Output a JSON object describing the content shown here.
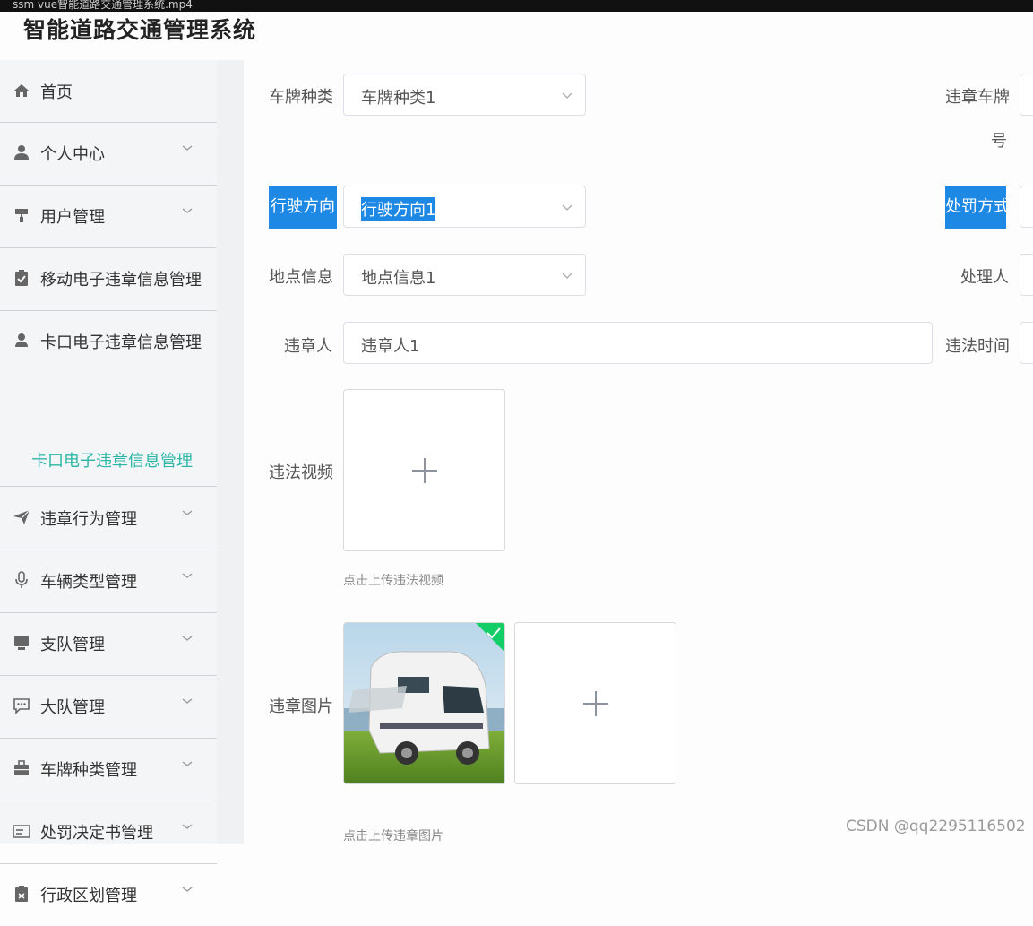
{
  "video_bar": {
    "title": "ssm vue智能道路交通管理系统.mp4"
  },
  "app": {
    "title": "智能道路交通管理系统"
  },
  "sidebar": {
    "items": [
      {
        "label": "首页",
        "icon": "home-icon"
      },
      {
        "label": "个人中心",
        "icon": "user-icon"
      },
      {
        "label": "用户管理",
        "icon": "paint-roller-icon"
      },
      {
        "label": "移动电子违章信息管理",
        "icon": "clipboard-check-icon"
      },
      {
        "label": "卡口电子违章信息管理",
        "icon": "user-tie-icon"
      },
      {
        "label": "违章行为管理",
        "icon": "paper-plane-icon"
      },
      {
        "label": "车辆类型管理",
        "icon": "microphone-icon"
      },
      {
        "label": "支队管理",
        "icon": "desktop-icon"
      },
      {
        "label": "大队管理",
        "icon": "chat-icon"
      },
      {
        "label": "车牌种类管理",
        "icon": "briefcase-icon"
      },
      {
        "label": "处罚决定书管理",
        "icon": "id-card-icon"
      },
      {
        "label": "行政区划管理",
        "icon": "clipboard-icon"
      }
    ],
    "submenu_active": "卡口电子违章信息管理",
    "active_color": "#2bb6a6"
  },
  "form": {
    "plate_type": {
      "label": "车牌种类",
      "value": "车牌种类1"
    },
    "violation_plate": {
      "label_line1": "违章车牌",
      "label_line2": "号"
    },
    "direction": {
      "label": "行驶方向",
      "value": "行驶方向1"
    },
    "penalty_method": {
      "label": "处罚方式"
    },
    "location": {
      "label": "地点信息",
      "value": "地点信息1"
    },
    "handler": {
      "label": "处理人"
    },
    "violator": {
      "label": "违章人",
      "value": "违章人1"
    },
    "violation_time": {
      "label": "违法时间"
    },
    "video": {
      "label": "违法视频",
      "hint": "点击上传违法视频"
    },
    "image": {
      "label": "违章图片",
      "hint": "点击上传违章图片"
    }
  },
  "highlight_color": "#1e88e5",
  "watermark": "CSDN @qq2295116502"
}
